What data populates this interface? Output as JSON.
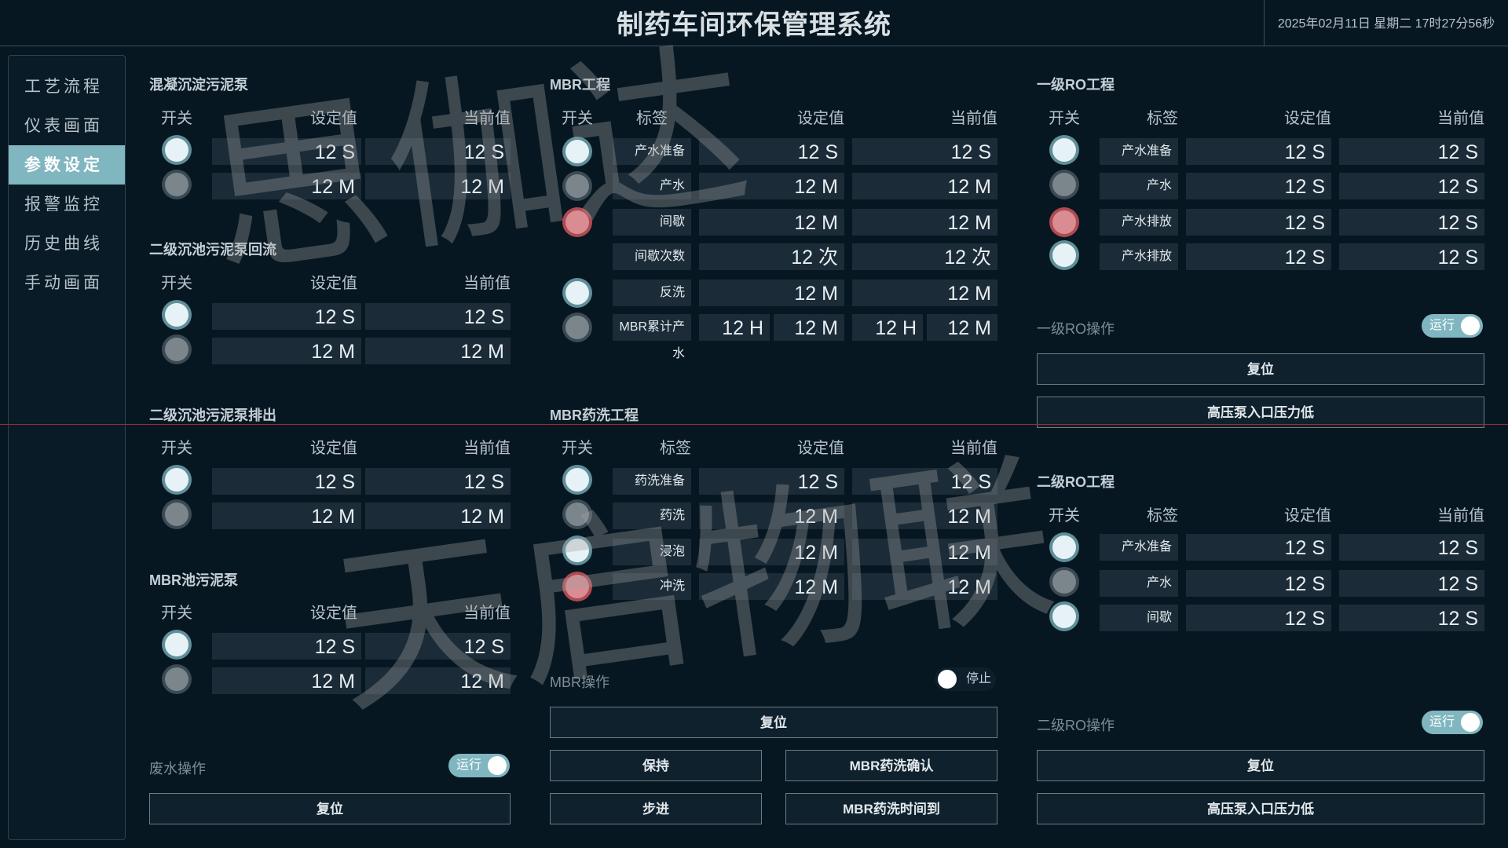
{
  "header": {
    "title": "制药车间环保管理系统",
    "datetime": "2025年02月11日 星期二 17时27分56秒"
  },
  "sidebar": {
    "items": [
      "工艺流程",
      "仪表画面",
      "参数设定",
      "报警监控",
      "历史曲线",
      "手动画面"
    ]
  },
  "labels": {
    "switch": "开关",
    "tag": "标签",
    "setpoint": "设定值",
    "current": "当前值"
  },
  "sections": {
    "coag": {
      "title": "混凝沉淀污泥泵",
      "rows": [
        {
          "state": "on",
          "set": "12 S",
          "cur": "12 S"
        },
        {
          "state": "off",
          "set": "12 M",
          "cur": "12 M"
        }
      ]
    },
    "sec_return": {
      "title": "二级沉池污泥泵回流",
      "rows": [
        {
          "state": "on",
          "set": "12 S",
          "cur": "12 S"
        },
        {
          "state": "off",
          "set": "12 M",
          "cur": "12 M"
        }
      ]
    },
    "sec_discharge": {
      "title": "二级沉池污泥泵排出",
      "rows": [
        {
          "state": "on",
          "set": "12 S",
          "cur": "12 S"
        },
        {
          "state": "off",
          "set": "12 M",
          "cur": "12 M"
        }
      ]
    },
    "mbr_sludge": {
      "title": "MBR池污泥泵",
      "rows": [
        {
          "state": "on",
          "set": "12 S",
          "cur": "12 S"
        },
        {
          "state": "off",
          "set": "12 M",
          "cur": "12 M"
        }
      ]
    },
    "mbr": {
      "title": "MBR工程",
      "rows": [
        {
          "state": "on",
          "tag": "产水准备",
          "set": "12 S",
          "cur": "12 S"
        },
        {
          "state": "off",
          "tag": "产水",
          "set": "12 M",
          "cur": "12 M"
        },
        {
          "state": "alarm",
          "tag": "间歇",
          "set": "12 M",
          "cur": "12 M"
        },
        {
          "state": "",
          "tag": "间歇次数",
          "set": "12 次",
          "cur": "12 次"
        },
        {
          "state": "on",
          "tag": "反洗",
          "set": "12 M",
          "cur": "12 M"
        }
      ],
      "cumulative": {
        "state": "off",
        "tag": "MBR累计产水",
        "set_h": "12 H",
        "set_m": "12 M",
        "cur_h": "12 H",
        "cur_m": "12 M"
      }
    },
    "mbr_wash": {
      "title": "MBR药洗工程",
      "rows": [
        {
          "state": "on",
          "tag": "药洗准备",
          "set": "12 S",
          "cur": "12 S"
        },
        {
          "state": "off",
          "tag": "药洗",
          "set": "12 M",
          "cur": "12 M"
        },
        {
          "state": "on",
          "tag": "浸泡",
          "set": "12 M",
          "cur": "12 M"
        },
        {
          "state": "alarm",
          "tag": "冲洗",
          "set": "12 M",
          "cur": "12 M"
        }
      ]
    },
    "ro1": {
      "title": "一级RO工程",
      "rows": [
        {
          "state": "on",
          "tag": "产水准备",
          "set": "12 S",
          "cur": "12 S"
        },
        {
          "state": "off",
          "tag": "产水",
          "set": "12 S",
          "cur": "12 S"
        },
        {
          "state": "alarm",
          "tag": "产水排放",
          "set": "12 S",
          "cur": "12 S"
        },
        {
          "state": "on",
          "tag": "产水排放",
          "set": "12 S",
          "cur": "12 S"
        }
      ]
    },
    "ro2": {
      "title": "二级RO工程",
      "rows": [
        {
          "state": "on",
          "tag": "产水准备",
          "set": "12 S",
          "cur": "12 S"
        },
        {
          "state": "off",
          "tag": "产水",
          "set": "12 S",
          "cur": "12 S"
        },
        {
          "state": "on",
          "tag": "间歇",
          "set": "12 S",
          "cur": "12 S"
        }
      ]
    }
  },
  "operations": {
    "ro1": {
      "label": "一级RO操作",
      "toggle": "运行",
      "reset": "复位",
      "alarm_btn": "高压泵入口压力低"
    },
    "ro2": {
      "label": "二级RO操作",
      "toggle": "运行",
      "reset": "复位",
      "alarm_btn": "高压泵入口压力低"
    },
    "mbr": {
      "label": "MBR操作",
      "toggle": "停止",
      "reset": "复位",
      "hold": "保持",
      "step": "步进",
      "confirm": "MBR药洗确认",
      "time_up": "MBR药洗时间到"
    },
    "waste": {
      "label": "废水操作",
      "toggle": "运行",
      "reset": "复位"
    }
  },
  "watermark": {
    "line1": "思伽达",
    "line2": "天启物联"
  },
  "colors": {
    "accent": "#7fb6c0",
    "background": "#071722",
    "field": "#1b2c38",
    "alarm": "#b04a52"
  }
}
